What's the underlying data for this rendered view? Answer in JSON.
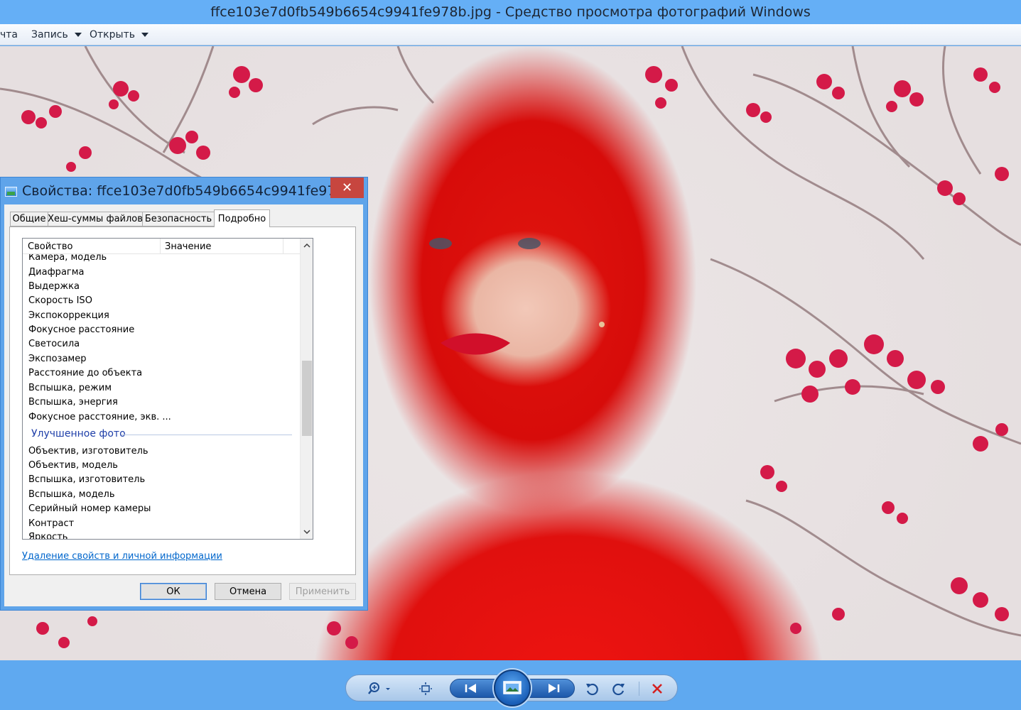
{
  "window": {
    "title": "ffce103e7d0fb549b6654c9941fe978b.jpg - Средство просмотра фотографий Windows"
  },
  "menu": {
    "items": [
      {
        "label": "чта"
      },
      {
        "label": "Запись"
      },
      {
        "label": "Открыть"
      }
    ]
  },
  "dialog": {
    "title": "Свойства: ffce103e7d0fb549b6654c9941fe978...",
    "close_icon": "close-icon",
    "close_color": "#c7463f",
    "tabs": [
      {
        "label": "Общие"
      },
      {
        "label": "Хеш-суммы файлов"
      },
      {
        "label": "Безопасность"
      },
      {
        "label": "Подробно",
        "active": true
      }
    ],
    "columns": {
      "property": "Свойство",
      "value": "Значение"
    },
    "rows_camera": [
      "Камера, модель",
      "Диафрагма",
      "Выдержка",
      "Скорость ISO",
      "Экспокоррекция",
      "Фокусное расстояние",
      "Светосила",
      "Экспозамер",
      "Расстояние до объекта",
      "Вспышка, режим",
      "Вспышка, энергия",
      "Фокусное расстояние, экв. ..."
    ],
    "group_enhanced": "Улучшенное фото",
    "rows_enhanced": [
      "Объектив, изготовитель",
      "Объектив, модель",
      "Вспышка, изготовитель",
      "Вспышка, модель",
      "Серийный номер камеры",
      "Контраст",
      "Яркость"
    ],
    "remove_link": "Удаление свойств и личной информации",
    "buttons": {
      "ok": "ОК",
      "cancel": "Отмена",
      "apply": "Применить"
    }
  },
  "toolbar": {
    "icons": [
      "zoom-icon",
      "fit-to-window-icon",
      "previous-icon",
      "slideshow-icon",
      "next-icon",
      "rotate-counterclockwise-icon",
      "rotate-clockwise-icon",
      "delete-icon"
    ],
    "accent": "#1c58aa",
    "delete_color": "#d42020"
  }
}
